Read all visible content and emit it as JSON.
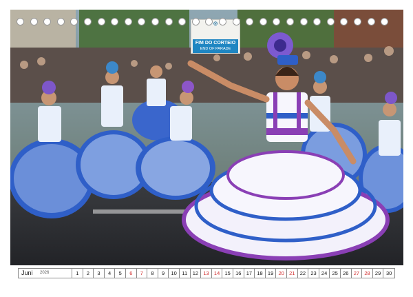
{
  "photo": {
    "subject": "carnival-dancers-photo",
    "sign": {
      "line1": "FIM DO CORTEIO",
      "line2": "END OF PARADE"
    }
  },
  "calendar": {
    "month": "Juni",
    "year": "2026",
    "days": [
      {
        "n": "1",
        "weekend": false
      },
      {
        "n": "2",
        "weekend": false
      },
      {
        "n": "3",
        "weekend": false
      },
      {
        "n": "4",
        "weekend": false
      },
      {
        "n": "5",
        "weekend": false
      },
      {
        "n": "6",
        "weekend": true
      },
      {
        "n": "7",
        "weekend": true
      },
      {
        "n": "8",
        "weekend": false
      },
      {
        "n": "9",
        "weekend": false
      },
      {
        "n": "10",
        "weekend": false
      },
      {
        "n": "11",
        "weekend": false
      },
      {
        "n": "12",
        "weekend": false
      },
      {
        "n": "13",
        "weekend": true
      },
      {
        "n": "14",
        "weekend": true
      },
      {
        "n": "15",
        "weekend": false
      },
      {
        "n": "16",
        "weekend": false
      },
      {
        "n": "17",
        "weekend": false
      },
      {
        "n": "18",
        "weekend": false
      },
      {
        "n": "19",
        "weekend": false
      },
      {
        "n": "20",
        "weekend": true
      },
      {
        "n": "21",
        "weekend": true
      },
      {
        "n": "22",
        "weekend": false
      },
      {
        "n": "23",
        "weekend": false
      },
      {
        "n": "24",
        "weekend": false
      },
      {
        "n": "25",
        "weekend": false
      },
      {
        "n": "26",
        "weekend": false
      },
      {
        "n": "27",
        "weekend": true
      },
      {
        "n": "28",
        "weekend": true
      },
      {
        "n": "29",
        "weekend": false
      },
      {
        "n": "30",
        "weekend": false
      }
    ]
  },
  "colors": {
    "weekend_day": "#d12a2a",
    "dress_blue": "#2f5fc8",
    "dress_purple": "#8a3fb5"
  }
}
